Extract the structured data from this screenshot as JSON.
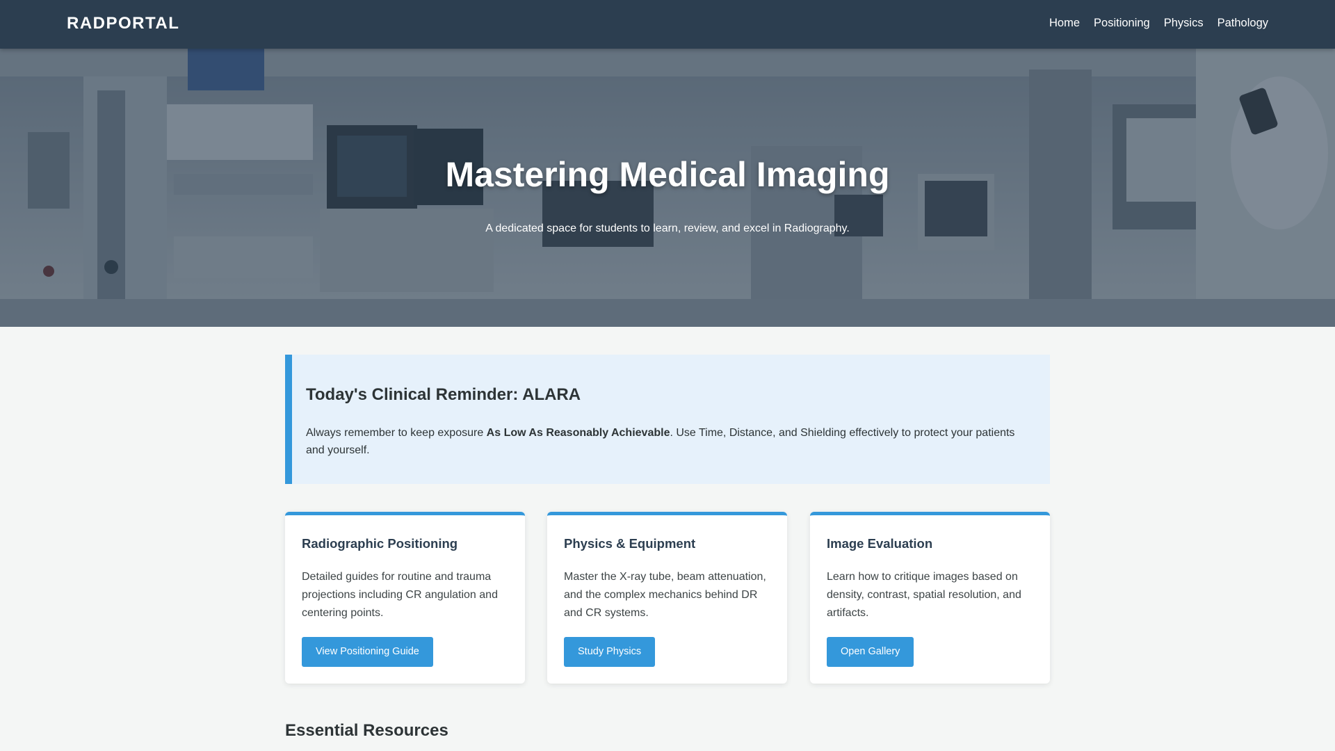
{
  "header": {
    "brand": "RADPORTAL",
    "nav": [
      "Home",
      "Positioning",
      "Physics",
      "Pathology"
    ]
  },
  "hero": {
    "title": "Mastering Medical Imaging",
    "subtitle": "A dedicated space for students to learn, review, and excel in Radiography."
  },
  "reminder": {
    "title": "Today's Clinical Reminder: ALARA",
    "text_before": "Always remember to keep exposure ",
    "text_bold": "As Low As Reasonably Achievable",
    "text_after": ". Use Time, Distance, and Shielding effectively to protect your patients and yourself."
  },
  "cards": [
    {
      "title": "Radiographic Positioning",
      "body": "Detailed guides for routine and trauma projections including CR angulation and centering points.",
      "button": "View Positioning Guide"
    },
    {
      "title": "Physics & Equipment",
      "body": "Master the X-ray tube, beam attenuation, and the complex mechanics behind DR and CR systems.",
      "button": "Study Physics"
    },
    {
      "title": "Image Evaluation",
      "body": "Learn how to critique images based on density, contrast, spatial resolution, and artifacts.",
      "button": "Open Gallery"
    }
  ],
  "resources": {
    "title": "Essential Resources"
  },
  "colors": {
    "header_bg": "#2c3e50",
    "accent": "#3498db",
    "reminder_bg": "#e6f1fb",
    "page_bg": "#f4f6f5"
  }
}
